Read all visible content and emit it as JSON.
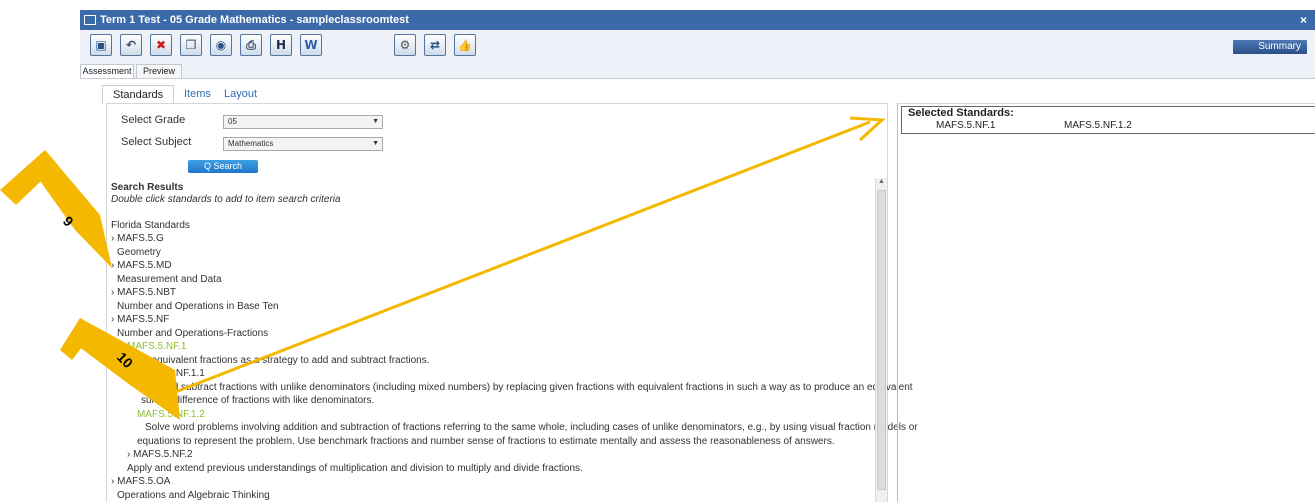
{
  "window": {
    "title": "Term 1 Test - 05 Grade Mathematics - sampleclassroomtest",
    "close": "×"
  },
  "toolbar": {
    "buttons": [
      {
        "icon": "save-icon",
        "glyph": "▣"
      },
      {
        "icon": "undo-icon",
        "glyph": "↶"
      },
      {
        "icon": "delete-icon",
        "glyph": "✖"
      },
      {
        "icon": "copy-icon",
        "glyph": "❐"
      },
      {
        "icon": "preview-icon",
        "glyph": "◉"
      },
      {
        "icon": "print-icon",
        "glyph": "⎙"
      },
      {
        "icon": "h-icon",
        "glyph": "H"
      },
      {
        "icon": "word-icon",
        "glyph": "W"
      },
      {
        "icon": "settings-icon",
        "glyph": "⚙"
      },
      {
        "icon": "swap-icon",
        "glyph": "⇄"
      },
      {
        "icon": "thumbs-up-icon",
        "glyph": "👍"
      }
    ],
    "summary": "Summary"
  },
  "subtabs": [
    "Assessment",
    "Preview"
  ],
  "tabs": [
    "Standards",
    "Items",
    "Layout"
  ],
  "form": {
    "grade_label": "Select Grade",
    "grade_value": "05",
    "subject_label": "Select Subject",
    "subject_value": "Mathematics",
    "search_label": "Q Search"
  },
  "results": {
    "title": "Search Results",
    "hint": "Double click standards to add to item search criteria",
    "lines": [
      "Florida Standards",
      "› MAFS.5.G",
      "Geometry",
      "› MAFS.5.MD",
      "Measurement and Data",
      "› MAFS.5.NBT",
      "Number and Operations in Base Ten",
      "› MAFS.5.NF",
      "Number and Operations-Fractions",
      "MAFS.5.NF.1",
      "Use equivalent fractions as a strategy to add and subtract fractions.",
      "MAFS.5.NF.1.1",
      "Add and subtract fractions with unlike denominators (including mixed numbers) by replacing given fractions with equivalent fractions in such a way as to produce an equivalent",
      "sum or difference of fractions with like denominators.",
      "MAFS.5.NF.1.2",
      "Solve word problems involving addition and subtraction of fractions referring to the same whole, including cases of unlike denominators, e.g., by using visual fraction models or",
      "equations to represent the problem. Use benchmark fractions and number sense of fractions to estimate mentally and assess the reasonableness of answers.",
      "› MAFS.5.NF.2",
      "Apply and extend previous understandings of multiplication and division to multiply and divide fractions.",
      "› MAFS.5.OA",
      "Operations and Algebraic Thinking"
    ]
  },
  "selected": {
    "title": "Selected Standards:",
    "items": [
      "MAFS.5.NF.1",
      "MAFS.5.NF.1.2"
    ]
  },
  "annotations": {
    "label_9": "9",
    "label_10": "10",
    "color": "#f5b800"
  }
}
